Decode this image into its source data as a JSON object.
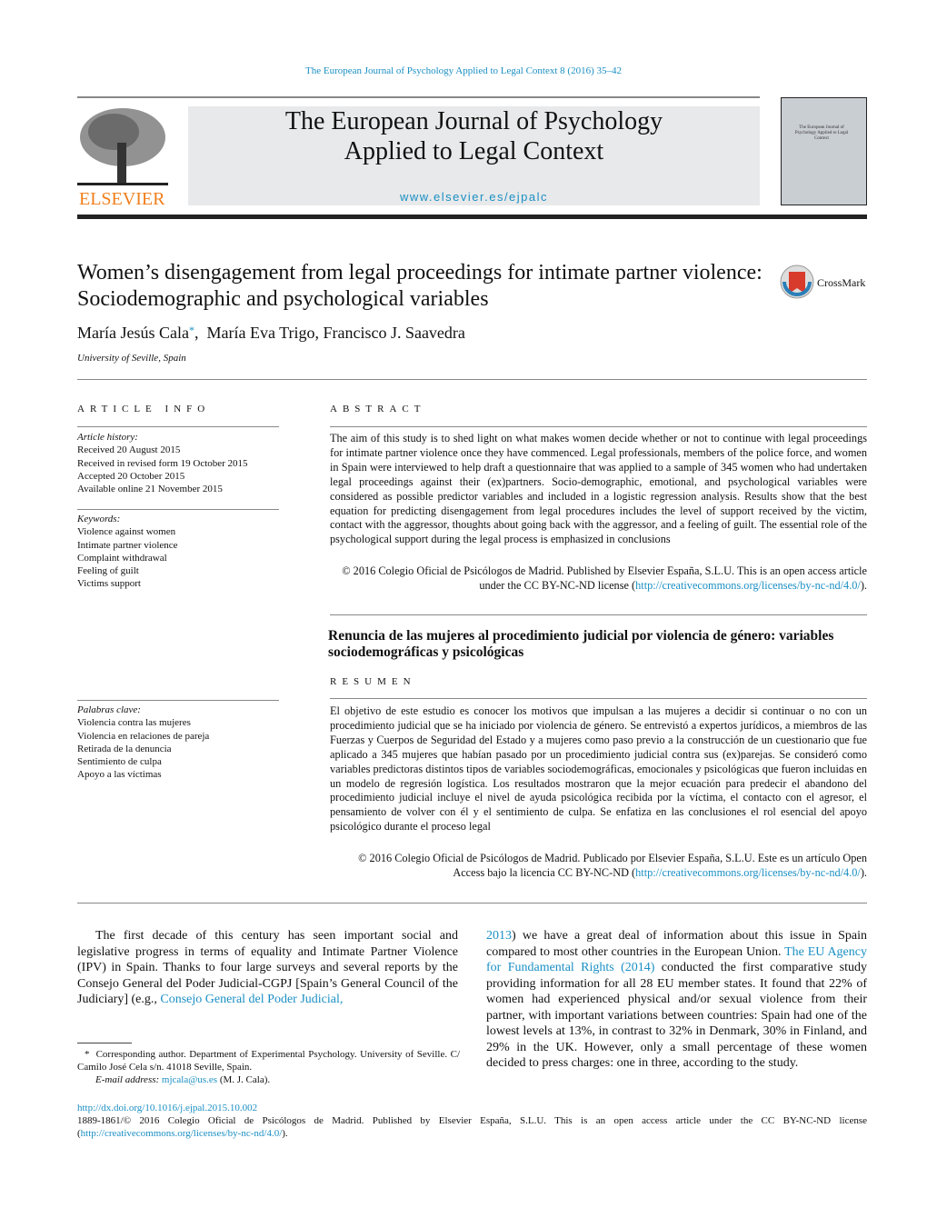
{
  "header": {
    "citation": "The European Journal of Psychology Applied to Legal Context 8  (2016) 35–42",
    "publisher_logo_text": "ELSEVIER",
    "journal_title_line1": "The European Journal of Psychology",
    "journal_title_line2": "Applied to Legal Context",
    "journal_url": "www.elsevier.es/ejpalc",
    "cover_text": "The European Journal of Psychology Applied to Legal Context"
  },
  "article": {
    "title": "Women’s disengagement from legal proceedings for intimate partner violence: Sociodemographic and psychological variables",
    "crossmark": "CrossMark",
    "author1": "María Jesús Cala",
    "author1_mark": "*",
    "authors_rest": "María Eva Trigo, Francisco J. Saavedra",
    "affiliation": "University of Seville, Spain"
  },
  "article_info": {
    "heading": "ARTICLE INFO",
    "history_label": "Article history:",
    "history": [
      "Received 20 August 2015",
      "Received in revised form 19 October 2015",
      "Accepted 20 October 2015",
      "Available online 21 November 2015"
    ],
    "keywords_label": "Keywords:",
    "keywords": [
      "Violence against women",
      "Intimate partner violence",
      "Complaint withdrawal",
      "Feeling of guilt",
      "Victims support"
    ],
    "palabras_label": "Palabras clave:",
    "palabras": [
      "Violencia contra las mujeres",
      "Violencia en relaciones de pareja",
      "Retirada de la denuncia",
      "Sentimiento de culpa",
      "Apoyo a las víctimas"
    ]
  },
  "abstract": {
    "heading": "ABSTRACT",
    "text": "The aim of this study is to shed light on what makes women decide whether or not to continue with legal proceedings for intimate partner violence once they have commenced. Legal professionals, members of the police force, and women in Spain were interviewed to help draft a questionnaire that was applied to a sample of 345 women who had undertaken legal proceedings against their (ex)partners. Socio-demographic, emotional, and psychological variables were considered as possible predictor variables and included in a logistic regression analysis. Results show that the best equation for predicting disengagement from legal procedures includes the level of support received by the victim, contact with the aggressor, thoughts about going back with the aggressor, and a feeling of guilt. The essential role of the psychological support during the legal process is emphasized in conclusions",
    "copyright": "© 2016 Colegio Oficial de Psicólogos de Madrid. Published by Elsevier España, S.L.U. This is an open access article under the CC BY-NC-ND license (",
    "license_url": "http://creativecommons.org/licenses/by-nc-nd/4.0/",
    "copyright_end": ")."
  },
  "spanish": {
    "title": "Renuncia de las mujeres al procedimiento judicial por violencia de género: variables sociodemográficas y psicológicas",
    "heading": "RESUMEN",
    "text": "El objetivo de este estudio es conocer los motivos que impulsan a las mujeres a decidir si continuar o no con un procedimiento judicial que se ha iniciado por violencia de género. Se entrevistó a expertos jurídicos, a miembros de las Fuerzas y Cuerpos de Seguridad del Estado y a mujeres como paso previo a la construcción de un cuestionario que fue aplicado a 345 mujeres que habían pasado por un procedimiento judicial contra sus (ex)parejas. Se consideró como variables predictoras distintos tipos de variables sociodemográficas, emocionales y psicológicas que fueron incluidas en un modelo de regresión logística. Los resultados mostraron que la mejor ecuación para predecir el abandono del procedimiento judicial incluye el nivel de ayuda psicológica recibida por la víctima, el contacto con el agresor, el pensamiento de volver con él y el sentimiento de culpa. Se enfatiza en las conclusiones el rol esencial del apoyo psicológico durante el proceso legal",
    "copyright": "© 2016 Colegio Oficial de Psicólogos de Madrid. Publicado por Elsevier España, S.L.U. Este es un artículo Open Access bajo la licencia CC BY-NC-ND (",
    "license_url": "http://creativecommons.org/licenses/by-nc-nd/4.0/",
    "copyright_end": ")."
  },
  "body": {
    "left_text": "The first decade of this century has seen important social and legislative progress in terms of equality and Intimate Partner Violence (IPV) in Spain. Thanks to four large surveys and several reports by the Consejo General del Poder Judicial-CGPJ [Spain’s General Council of the Judiciary] (e.g., ",
    "left_link": "Consejo General del Poder Judicial,",
    "right_link1": "2013",
    "right_text1": ") we have a great deal of information about this issue in Spain compared to most other countries in the European Union. ",
    "right_link2": "The EU Agency for Fundamental Rights (2014)",
    "right_text2": " conducted the first comparative study providing information for all 28 EU member states. It found that 22% of women had experienced physical and/or sexual violence from their partner, with important variations between countries: Spain had one of the lowest levels at 13%, in contrast to 32% in Denmark, 30% in Finland, and 29% in the UK. However, only a small percentage of these women decided to press charges: one in three, according to the study."
  },
  "footnote": {
    "mark": "*",
    "text": "Corresponding author. Department of Experimental Psychology. University of Seville. C/ Camilo José Cela s/n. 41018 Seville, Spain.",
    "email_label": "E-mail address:",
    "email": "mjcala@us.es",
    "email_suffix": "(M. J. Cala)."
  },
  "bottom": {
    "doi": "http://dx.doi.org/10.1016/j.ejpal.2015.10.002",
    "issn_line": "1889-1861/© 2016 Colegio Oficial de Psicólogos de Madrid. Published by Elsevier España, S.L.U. This is an open access article under the CC BY-NC-ND license (",
    "license_url": "http://creativecommons.org/licenses/by-nc-nd/4.0/",
    "end": ")."
  },
  "colors": {
    "link": "#1a8fc4",
    "elsevier_orange": "#f07e1b",
    "banner_bg": "#e8e9ea"
  }
}
